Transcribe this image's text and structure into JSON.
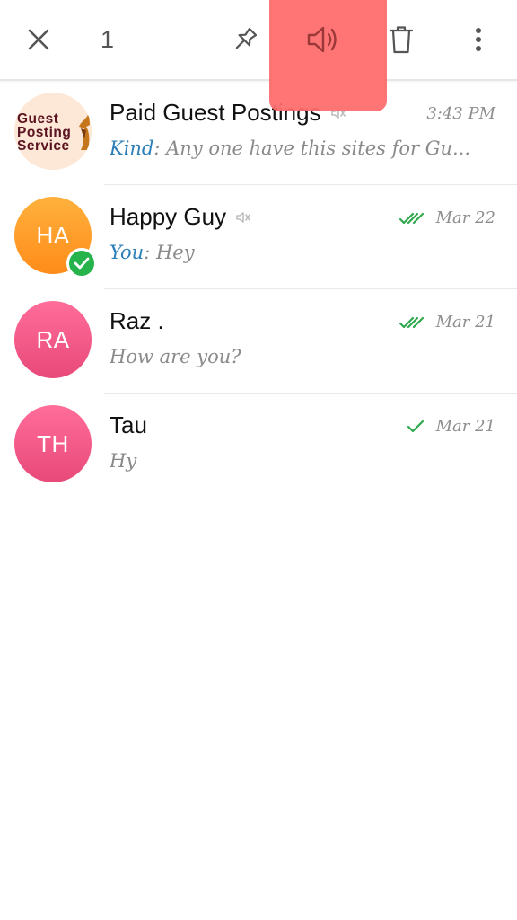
{
  "toolbar": {
    "selected_count": "1",
    "icons": [
      "close-icon",
      "pin-icon",
      "unmute-speaker-icon",
      "trash-icon",
      "more-vert-icon"
    ]
  },
  "colors": {
    "highlight": "#ff6b6b",
    "sender": "#2c7fb8",
    "read_ticks": "#2fa84f",
    "verified": "#26b34b",
    "avatar_orange": "#ff9a26",
    "avatar_pink": "#f0567f"
  },
  "chats": [
    {
      "name": "Paid Guest Postings",
      "avatar_lines": [
        "Guest",
        "Posting",
        "Service"
      ],
      "muted": true,
      "time": "3:43 PM",
      "sender": "Kind",
      "message": ": Any one have this sites for Gu..."
    },
    {
      "name": "Happy Guy",
      "initials": "HA",
      "muted": true,
      "verified": true,
      "ticks": "double",
      "time": "Mar 22",
      "sender": "You",
      "message": ": Hey"
    },
    {
      "name": "Raz .",
      "initials": "RA",
      "ticks": "double",
      "time": "Mar 21",
      "message": "How are you?"
    },
    {
      "name": "Tau",
      "initials": "TH",
      "ticks": "single",
      "time": "Mar 21",
      "message": "Hy"
    }
  ]
}
